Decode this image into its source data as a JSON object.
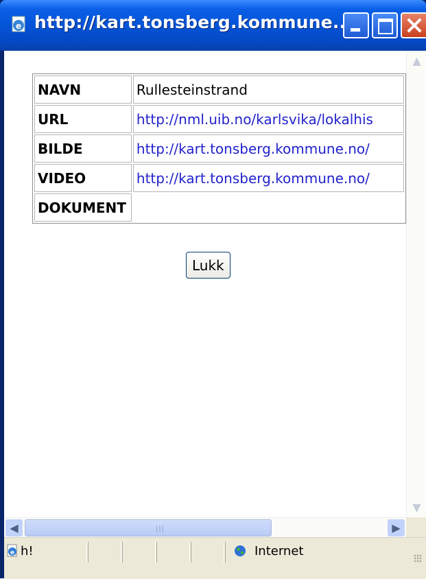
{
  "window": {
    "title": "http://kart.tonsberg.kommune....",
    "colors": {
      "titlebar": "#0552d4",
      "close": "#c9401c"
    }
  },
  "table": {
    "rows": [
      {
        "label": "NAVN",
        "value": "Rullesteinstrand"
      },
      {
        "label": "URL",
        "value": "http://nml.uib.no/karlsvika/lokalhis"
      },
      {
        "label": "BILDE",
        "value": "http://kart.tonsberg.kommune.no/"
      },
      {
        "label": "VIDEO",
        "value": "http://kart.tonsberg.kommune.no/"
      },
      {
        "label": "DOKUMENT",
        "value": ""
      }
    ]
  },
  "buttons": {
    "close_label": "Lukk"
  },
  "statusbar": {
    "text": "h!",
    "zone": "Internet"
  }
}
